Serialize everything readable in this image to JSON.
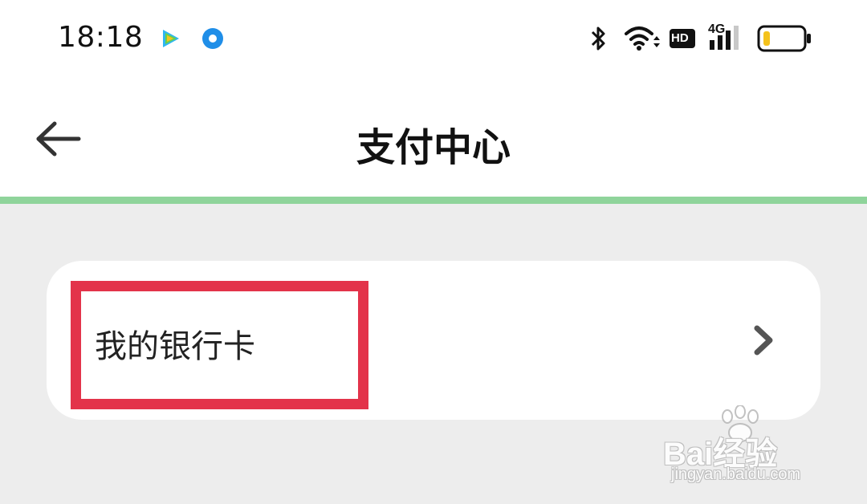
{
  "status_bar": {
    "time": "18:18",
    "icons": [
      "video-app-icon",
      "browser-app-icon",
      "bluetooth-icon",
      "wifi-icon",
      "hd-badge-icon",
      "4g-signal-icon",
      "battery-low-icon"
    ],
    "hd_label": "HD",
    "network_label": "4G"
  },
  "header": {
    "title": "支付中心",
    "back_icon": "arrow-left-icon"
  },
  "menu": {
    "items": [
      {
        "label": "我的银行卡",
        "icon": "chevron-right-icon",
        "highlighted": true
      }
    ]
  },
  "watermark": {
    "brand": "Bai经验",
    "url": "jingyan.baidu.com"
  },
  "colors": {
    "accent_line": "#8fd49b",
    "highlight_border": "#e3334a",
    "background": "#ededed",
    "battery_level": "#f4c21c"
  }
}
